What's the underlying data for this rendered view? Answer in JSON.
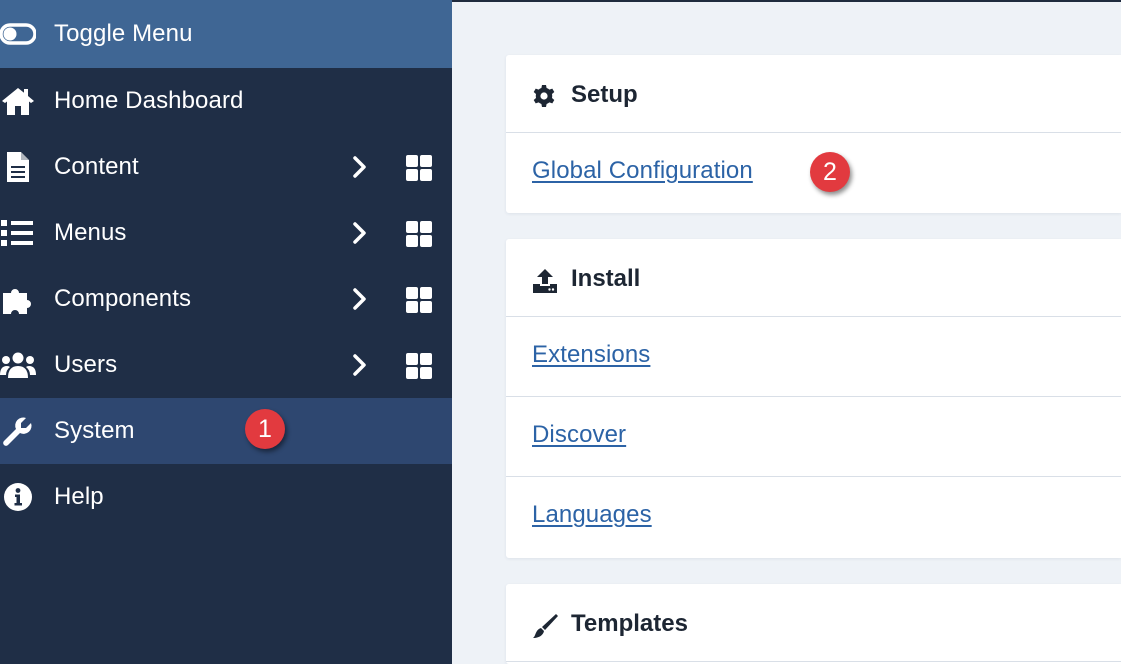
{
  "sidebar": {
    "toggle_label": "Toggle Menu",
    "items": [
      {
        "label": "Home Dashboard",
        "icon": "home-icon"
      },
      {
        "label": "Content",
        "icon": "file-icon",
        "has_submenu": true,
        "has_dashboard": true
      },
      {
        "label": "Menus",
        "icon": "list-icon",
        "has_submenu": true,
        "has_dashboard": true
      },
      {
        "label": "Components",
        "icon": "puzzle-icon",
        "has_submenu": true,
        "has_dashboard": true
      },
      {
        "label": "Users",
        "icon": "users-icon",
        "has_submenu": true,
        "has_dashboard": true
      },
      {
        "label": "System",
        "icon": "wrench-icon",
        "active": true
      },
      {
        "label": "Help",
        "icon": "info-icon"
      }
    ]
  },
  "annotations": {
    "badge_1": "1",
    "badge_2": "2"
  },
  "main": {
    "setup": {
      "title": "Setup",
      "links": [
        "Global Configuration"
      ]
    },
    "install": {
      "title": "Install",
      "links": [
        "Extensions",
        "Discover",
        "Languages"
      ]
    },
    "templates": {
      "title": "Templates"
    }
  },
  "colors": {
    "sidebar_bg": "#1f2e46",
    "toggle_bg": "#3f6694",
    "active_bg": "#2e4770",
    "link": "#2c63a6",
    "badge": "#e23a3f",
    "page_bg": "#eef2f7"
  }
}
